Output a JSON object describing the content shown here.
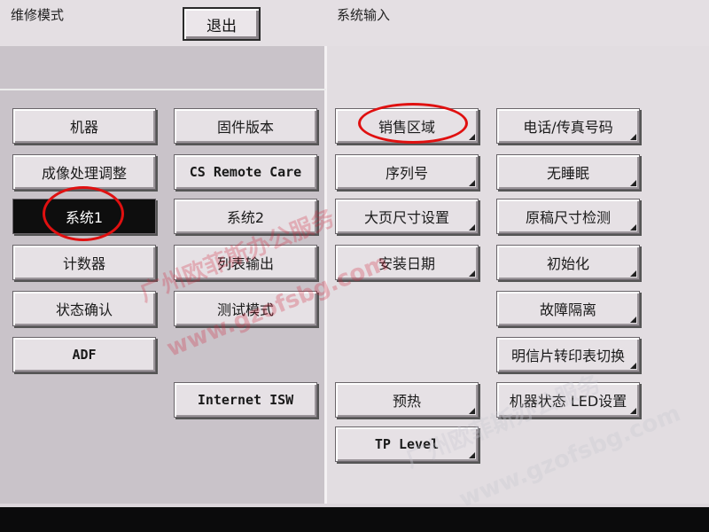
{
  "header": {
    "left_title": "维修模式",
    "right_title": "系统输入",
    "exit_label": "退出"
  },
  "left_col1": [
    "机器",
    "成像处理调整",
    "系统1",
    "计数器",
    "状态确认",
    "ADF"
  ],
  "left_col2": [
    "固件版本",
    "CS Remote Care",
    "系统2",
    "列表输出",
    "测试模式",
    "Internet ISW"
  ],
  "right_col1": [
    "销售区域",
    "序列号",
    "大页尺寸设置",
    "安装日期",
    "预热",
    "TP Level"
  ],
  "right_col2": [
    "电话/传真号码",
    "无睡眠",
    "原稿尺寸检测",
    "初始化",
    "故障隔离",
    "明信片转印表切换",
    "机器状态 LED设置"
  ],
  "selected": "系统1",
  "watermark": {
    "text1": "广州欧菲斯办公服务",
    "text2": "www.gzofsbg.com",
    "text3": "广州欧菲斯办公服务",
    "text4": "www.gzofsbg.com"
  },
  "colors": {
    "annotation_circle": "#e01010",
    "selected_bg": "#0e0e0e"
  }
}
